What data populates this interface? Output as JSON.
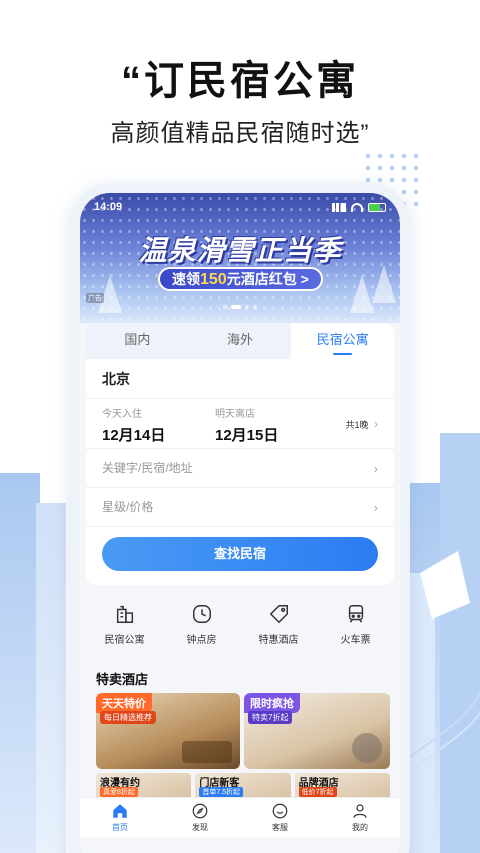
{
  "promo": {
    "title": "“订民宿公寓",
    "subtitle": "高颜值精品民宿随时选”"
  },
  "status_bar": {
    "time": "14:09"
  },
  "banner": {
    "title": "温泉滑雪正当季",
    "pill_prefix": "速领",
    "pill_amount": "150",
    "pill_suffix": "元酒店红包",
    "pill_arrow": ">",
    "tag": "广告"
  },
  "search": {
    "tabs": [
      {
        "label": "国内",
        "active": false
      },
      {
        "label": "海外",
        "active": false
      },
      {
        "label": "民宿公寓",
        "active": true
      }
    ],
    "city": "北京",
    "checkin_label": "今天入住",
    "checkin_date": "12月14日",
    "checkout_label": "明天离店",
    "checkout_date": "12月15日",
    "nights": "共1晚",
    "keyword_placeholder": "关键字/民宿/地址",
    "star_price_placeholder": "星级/价格",
    "submit_label": "查找民宿",
    "chevron": "›"
  },
  "quick_links": [
    {
      "label": "民宿公寓",
      "icon": "building-icon"
    },
    {
      "label": "钟点房",
      "icon": "clock-icon"
    },
    {
      "label": "特惠酒店",
      "icon": "tag-icon"
    },
    {
      "label": "火车票",
      "icon": "train-icon"
    }
  ],
  "deals": {
    "section_title": "特卖酒店",
    "featured": [
      {
        "title": "天天特价",
        "subtitle": "每日精选推荐"
      },
      {
        "title": "限时疯抢",
        "subtitle": "特卖7折起"
      }
    ],
    "small": [
      {
        "title": "浪漫有约",
        "subtitle": "真爱8折起"
      },
      {
        "title": "门店新客",
        "subtitle": "首单7.5折起"
      },
      {
        "title": "品牌酒店",
        "subtitle": "低价7折起"
      }
    ]
  },
  "bottom_nav": [
    {
      "label": "首页",
      "icon": "home-icon",
      "active": true
    },
    {
      "label": "发现",
      "icon": "compass-icon",
      "active": false
    },
    {
      "label": "客服",
      "icon": "service-icon",
      "active": false
    },
    {
      "label": "我的",
      "icon": "user-icon",
      "active": false
    }
  ],
  "colors": {
    "accent": "#2b7cf2",
    "deal_orange": "#ff6a2b",
    "deal_purple": "#7b55e6"
  }
}
